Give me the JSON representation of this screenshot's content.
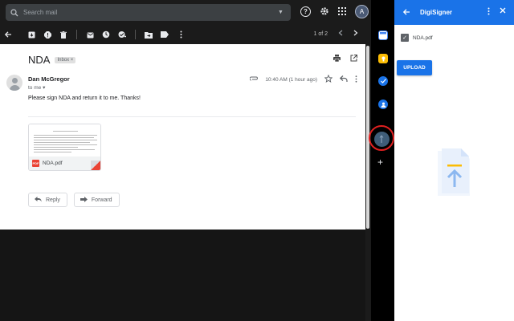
{
  "search": {
    "placeholder": "Search mail"
  },
  "account": {
    "initial": "A"
  },
  "toolbar": {
    "pager_text": "1 of 2",
    "icons": [
      "back-arrow",
      "archive",
      "report-spam",
      "delete",
      "mark-unread",
      "snooze",
      "add-to-tasks",
      "move-to",
      "labels",
      "more"
    ]
  },
  "email": {
    "subject": "NDA",
    "label": "Inbox",
    "sender": "Dan McGregor",
    "recipient": "to me",
    "time": "10:40 AM (1 hour ago)",
    "body": "Please sign NDA and return it to me. Thanks!",
    "attachment": {
      "name": "NDA.pdf",
      "type_badge": "PDF"
    },
    "reply_label": "Reply",
    "forward_label": "Forward"
  },
  "addons": [
    {
      "name": "calendar",
      "color": "#4285f4"
    },
    {
      "name": "keep",
      "color": "#fbbc04"
    },
    {
      "name": "tasks",
      "color": "#1a73e8"
    },
    {
      "name": "contacts",
      "color": "#1a73e8"
    },
    {
      "name": "digisigner",
      "color": "#3f5d78",
      "active": true
    }
  ],
  "panel": {
    "title": "DigiSigner",
    "file_name": "NDA.pdf",
    "file_checked": true,
    "upload_label": "UPLOAD"
  },
  "colors": {
    "accent": "#1a73e8",
    "highlight_ring": "#e02020",
    "pdf_red": "#ea4335"
  }
}
